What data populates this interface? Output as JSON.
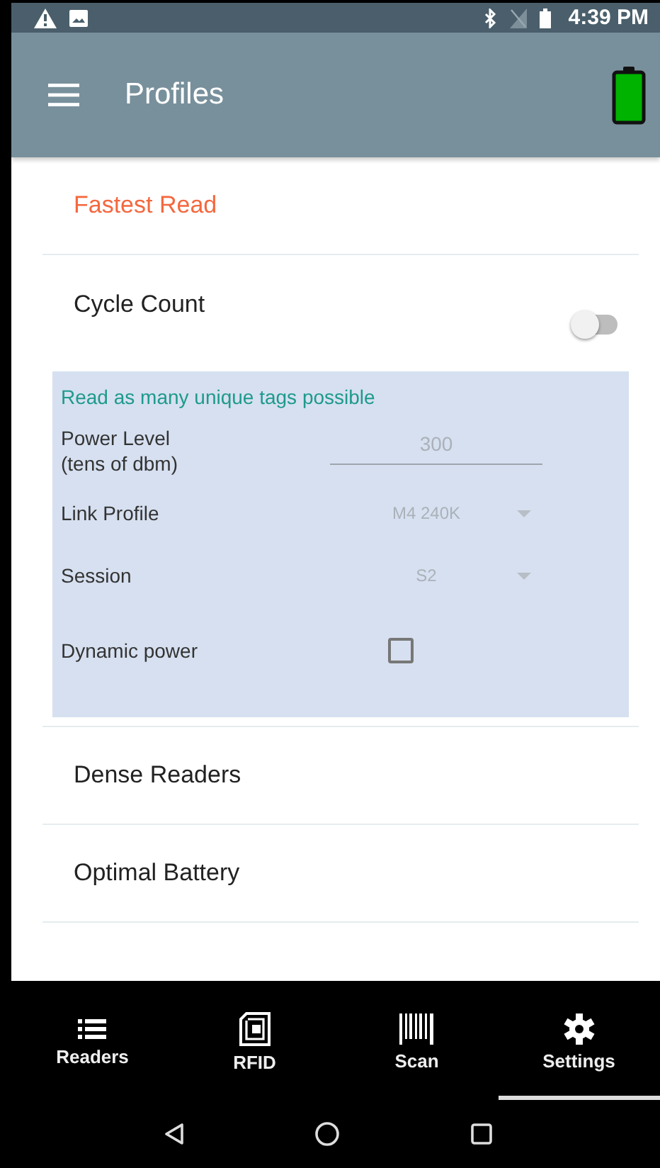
{
  "status_bar": {
    "time": "4:39 PM"
  },
  "app_bar": {
    "title": "Profiles"
  },
  "profiles": [
    {
      "name": "Fastest Read",
      "selected": true
    },
    {
      "name": "Cycle Count",
      "selected": false,
      "kind": "toggle",
      "on": false,
      "expanded": true,
      "details": {
        "description": "Read as many unique tags possible",
        "fields": [
          {
            "kind": "input",
            "label": "Power Level\n(tens of dbm)",
            "value": "300",
            "disabled": true
          },
          {
            "kind": "dropdown",
            "label": "Link Profile",
            "value": "M4 240K",
            "disabled": true
          },
          {
            "kind": "dropdown",
            "label": "Session",
            "value": "S2",
            "disabled": true
          },
          {
            "kind": "checkbox",
            "label": "Dynamic power",
            "checked": false
          }
        ]
      }
    },
    {
      "name": "Dense Readers",
      "selected": false
    },
    {
      "name": "Optimal Battery",
      "selected": false
    }
  ],
  "bottom_nav": [
    {
      "label": "Readers",
      "selected": false
    },
    {
      "label": "RFID",
      "selected": false
    },
    {
      "label": "Scan",
      "selected": false
    },
    {
      "label": "Settings",
      "selected": true
    }
  ]
}
